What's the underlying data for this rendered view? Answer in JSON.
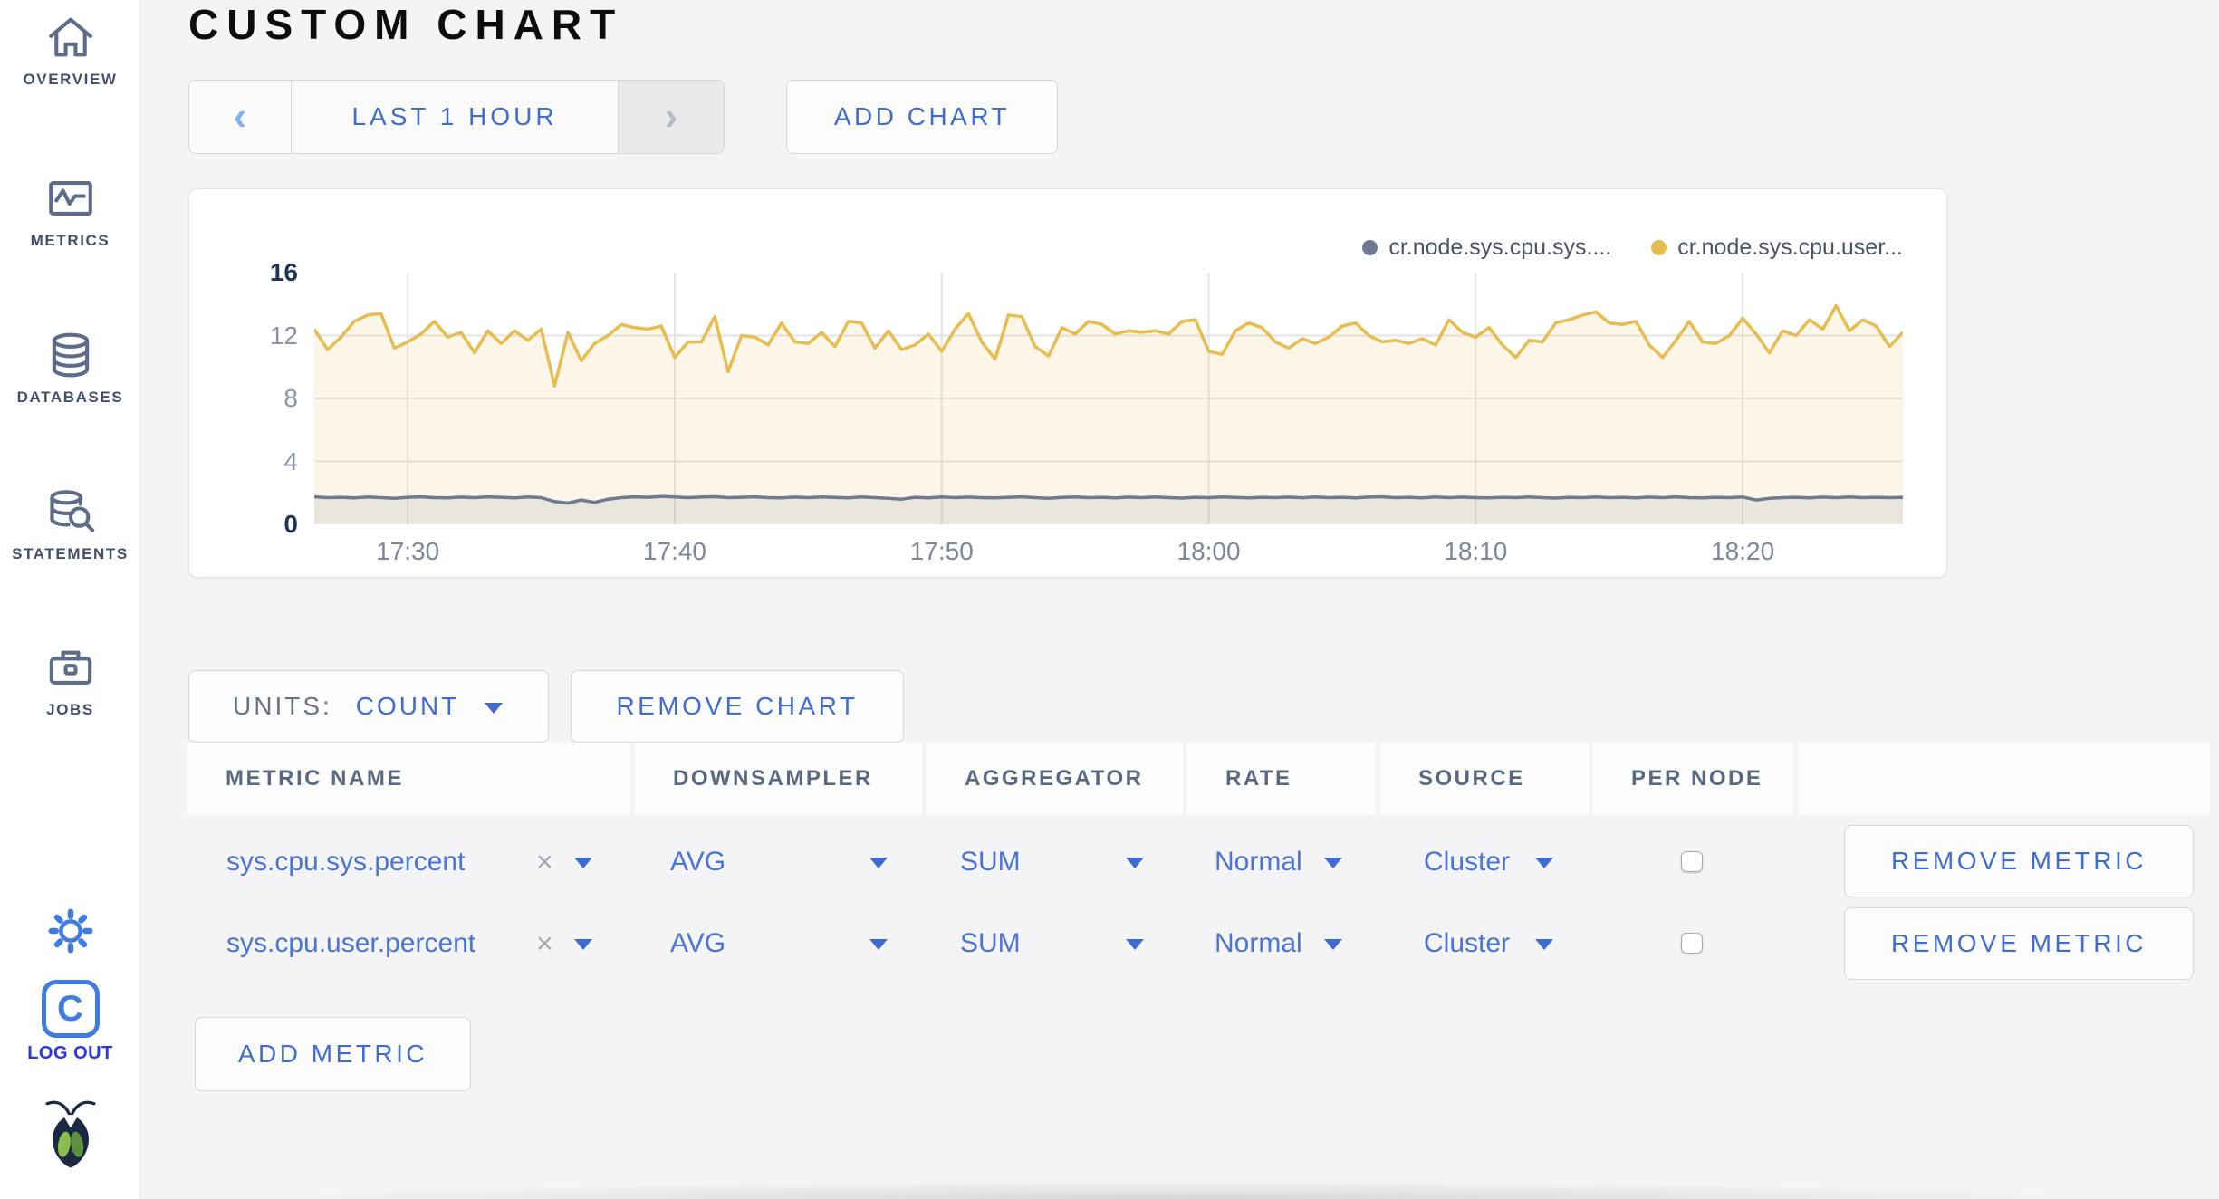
{
  "sidebar": {
    "items": [
      {
        "label": "OVERVIEW",
        "icon": "home-icon"
      },
      {
        "label": "METRICS",
        "icon": "metrics-icon"
      },
      {
        "label": "DATABASES",
        "icon": "database-icon"
      },
      {
        "label": "STATEMENTS",
        "icon": "statements-icon"
      },
      {
        "label": "JOBS",
        "icon": "jobs-icon"
      }
    ],
    "settings_icon": "gear-icon",
    "logout_label": "LOG OUT",
    "logo_icon": "cockroach-bug-logo"
  },
  "header": {
    "title": "CUSTOM CHART"
  },
  "time_controls": {
    "prev_label": "‹",
    "range_label": "LAST 1 HOUR",
    "next_label": "›",
    "next_disabled": true,
    "add_chart_label": "ADD CHART"
  },
  "chart_data": {
    "type": "line",
    "title": "",
    "xlabel": "",
    "ylabel": "",
    "ylim": [
      0,
      16
    ],
    "y_ticks": [
      16,
      12,
      8,
      4,
      0
    ],
    "y_gridlines": [
      4,
      8,
      12
    ],
    "grid": true,
    "grid_color": "#e4e4e7",
    "legend_position": "top-right",
    "x_start": "17:26:30",
    "x_interval_seconds": 30,
    "x_tick_labels": [
      "17:30",
      "17:40",
      "17:50",
      "18:00",
      "18:10",
      "18:20"
    ],
    "series": [
      {
        "name": "cr.node.sys.cpu.sys....",
        "color": "#6f7991",
        "fill": "rgba(111,121,145,0.13)",
        "values": [
          1.75,
          1.7,
          1.72,
          1.68,
          1.74,
          1.7,
          1.66,
          1.72,
          1.75,
          1.7,
          1.68,
          1.73,
          1.7,
          1.75,
          1.72,
          1.68,
          1.74,
          1.7,
          1.45,
          1.35,
          1.55,
          1.4,
          1.6,
          1.7,
          1.75,
          1.72,
          1.78,
          1.74,
          1.7,
          1.73,
          1.76,
          1.7,
          1.72,
          1.75,
          1.7,
          1.68,
          1.73,
          1.7,
          1.74,
          1.71,
          1.68,
          1.74,
          1.7,
          1.66,
          1.6,
          1.72,
          1.68,
          1.74,
          1.7,
          1.73,
          1.7,
          1.68,
          1.72,
          1.75,
          1.7,
          1.66,
          1.71,
          1.74,
          1.7,
          1.72,
          1.68,
          1.73,
          1.7,
          1.74,
          1.7,
          1.67,
          1.72,
          1.7,
          1.74,
          1.71,
          1.68,
          1.72,
          1.7,
          1.73,
          1.69,
          1.74,
          1.7,
          1.72,
          1.68,
          1.73,
          1.75,
          1.7,
          1.72,
          1.68,
          1.74,
          1.7,
          1.73,
          1.7,
          1.68,
          1.72,
          1.7,
          1.74,
          1.7,
          1.67,
          1.72,
          1.7,
          1.74,
          1.7,
          1.72,
          1.68,
          1.73,
          1.7,
          1.75,
          1.7,
          1.68,
          1.72,
          1.7,
          1.74,
          1.55,
          1.65,
          1.7,
          1.72,
          1.68,
          1.73,
          1.7,
          1.74,
          1.7,
          1.72,
          1.7,
          1.71
        ]
      },
      {
        "name": "cr.node.sys.cpu.user...",
        "color": "#e8bc4f",
        "fill": "rgba(232,188,79,0.13)",
        "values": [
          12.4,
          11.1,
          11.9,
          12.9,
          13.3,
          13.4,
          11.2,
          11.6,
          12.1,
          12.9,
          11.9,
          12.2,
          10.9,
          12.3,
          11.5,
          12.3,
          11.7,
          12.4,
          8.8,
          12.2,
          10.4,
          11.5,
          12.0,
          12.7,
          12.5,
          12.4,
          12.6,
          10.6,
          11.6,
          11.6,
          13.2,
          9.7,
          12.0,
          11.9,
          11.4,
          12.8,
          11.6,
          11.5,
          12.2,
          11.3,
          12.9,
          12.8,
          11.2,
          12.3,
          11.1,
          11.4,
          12.1,
          11.0,
          12.4,
          13.4,
          11.6,
          10.5,
          13.3,
          13.2,
          11.3,
          10.7,
          12.5,
          12.1,
          12.9,
          12.7,
          12.1,
          12.3,
          12.2,
          12.3,
          12.1,
          12.9,
          13.0,
          11.0,
          10.8,
          12.3,
          12.8,
          12.5,
          11.6,
          11.2,
          11.8,
          11.5,
          11.9,
          12.6,
          12.8,
          12.0,
          11.6,
          11.7,
          11.5,
          11.8,
          11.4,
          13.0,
          12.2,
          11.9,
          12.5,
          11.4,
          10.6,
          11.7,
          11.6,
          12.8,
          13.0,
          13.3,
          13.5,
          12.8,
          12.7,
          12.9,
          11.4,
          10.6,
          11.7,
          12.9,
          11.6,
          11.5,
          12.0,
          13.1,
          12.1,
          10.9,
          12.3,
          12.0,
          13.0,
          12.4,
          13.9,
          12.3,
          13.0,
          12.6,
          11.3,
          12.2
        ]
      }
    ]
  },
  "units": {
    "label": "UNITS:",
    "value": "COUNT"
  },
  "remove_chart_label": "REMOVE CHART",
  "metrics_table": {
    "columns": [
      "METRIC NAME",
      "DOWNSAMPLER",
      "AGGREGATOR",
      "RATE",
      "SOURCE",
      "PER NODE"
    ],
    "clear_label": "×",
    "rows": [
      {
        "metric_name": "sys.cpu.sys.percent",
        "downsampler": "AVG",
        "aggregator": "SUM",
        "rate": "Normal",
        "source": "Cluster",
        "per_node_checked": false,
        "remove_label": "REMOVE METRIC"
      },
      {
        "metric_name": "sys.cpu.user.percent",
        "downsampler": "AVG",
        "aggregator": "SUM",
        "rate": "Normal",
        "source": "Cluster",
        "per_node_checked": false,
        "remove_label": "REMOVE METRIC"
      }
    ],
    "add_metric_label": "ADD METRIC"
  },
  "colors": {
    "accent_blue": "#3f6cd3",
    "logout_blue": "#2838e0",
    "icon_slate": "#5d6c8b",
    "series_yellow": "#e8bc4f",
    "series_slate": "#6f7991",
    "page_background": "#f4f4f6"
  }
}
